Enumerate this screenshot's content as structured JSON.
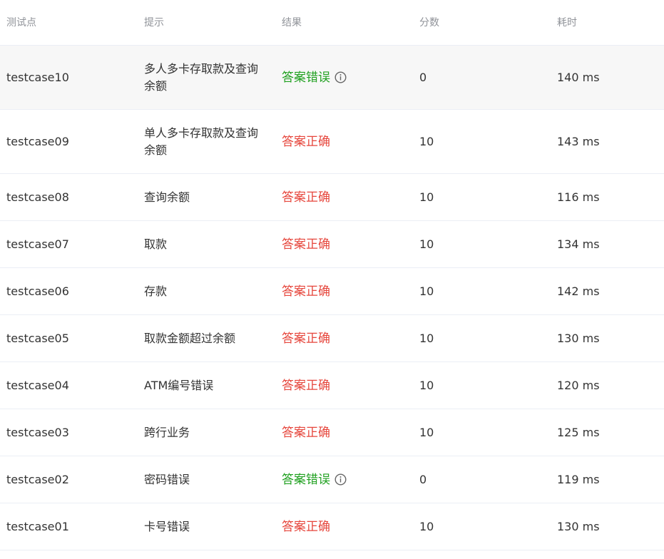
{
  "colors": {
    "correct": "#e6463c",
    "wrong": "#1fa01f",
    "header_text": "#909399",
    "divider": "#ebeef5",
    "highlight_row": "#f7f7f7"
  },
  "header": {
    "testcase": "测试点",
    "hint": "提示",
    "result": "结果",
    "score": "分数",
    "time": "耗时"
  },
  "rows": [
    {
      "testcase": "testcase10",
      "hint": "多人多卡存取款及查询余额",
      "result": "答案错误",
      "status": "wrong",
      "score": "0",
      "time": "140 ms"
    },
    {
      "testcase": "testcase09",
      "hint": "单人多卡存取款及查询余额",
      "result": "答案正确",
      "status": "correct",
      "score": "10",
      "time": "143 ms"
    },
    {
      "testcase": "testcase08",
      "hint": "查询余额",
      "result": "答案正确",
      "status": "correct",
      "score": "10",
      "time": "116 ms"
    },
    {
      "testcase": "testcase07",
      "hint": "取款",
      "result": "答案正确",
      "status": "correct",
      "score": "10",
      "time": "134 ms"
    },
    {
      "testcase": "testcase06",
      "hint": "存款",
      "result": "答案正确",
      "status": "correct",
      "score": "10",
      "time": "142 ms"
    },
    {
      "testcase": "testcase05",
      "hint": "取款金额超过余额",
      "result": "答案正确",
      "status": "correct",
      "score": "10",
      "time": "130 ms"
    },
    {
      "testcase": "testcase04",
      "hint": "ATM编号错误",
      "result": "答案正确",
      "status": "correct",
      "score": "10",
      "time": "120 ms"
    },
    {
      "testcase": "testcase03",
      "hint": "跨行业务",
      "result": "答案正确",
      "status": "correct",
      "score": "10",
      "time": "125 ms"
    },
    {
      "testcase": "testcase02",
      "hint": "密码错误",
      "result": "答案错误",
      "status": "wrong",
      "score": "0",
      "time": "119 ms"
    },
    {
      "testcase": "testcase01",
      "hint": "卡号错误",
      "result": "答案正确",
      "status": "correct",
      "score": "10",
      "time": "130 ms"
    }
  ],
  "icons": {
    "wrong_info": "info-circle-icon"
  }
}
